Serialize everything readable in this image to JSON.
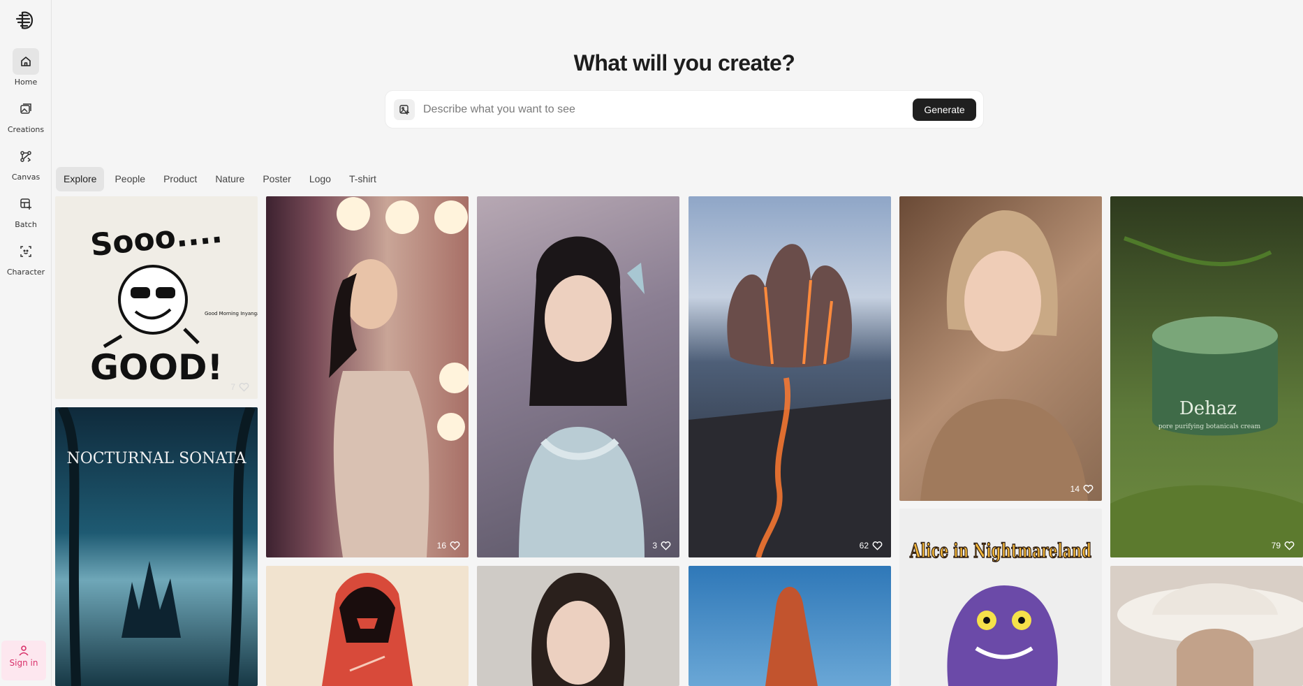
{
  "nav": [
    {
      "label": "Home",
      "icon": "home-icon",
      "active": true
    },
    {
      "label": "Creations",
      "icon": "image-icon"
    },
    {
      "label": "Canvas",
      "icon": "canvas-icon"
    },
    {
      "label": "Batch",
      "icon": "batch-icon"
    },
    {
      "label": "Character",
      "icon": "character-icon"
    }
  ],
  "signin_label": "Sign in",
  "heading": "What will you create?",
  "prompt": {
    "placeholder": "Describe what you want to see",
    "generate_label": "Generate"
  },
  "tabs": [
    "Explore",
    "People",
    "Product",
    "Nature",
    "Poster",
    "Logo",
    "T-shirt"
  ],
  "cards": {
    "sooo_good": {
      "title_top": "Sooo....",
      "title_bottom": "GOOD!",
      "small_text": "Good Morning Inyanga",
      "likes": "7"
    },
    "nocturnal": {
      "title": "NOCTURNAL SONATA"
    },
    "silk_dress": {
      "likes": "16"
    },
    "blue_ruffle": {
      "likes": "3"
    },
    "lava": {
      "likes": "62"
    },
    "blonde": {
      "likes": "14"
    },
    "dehaz": {
      "brand": "Dehaz",
      "tagline": "pore purifying botanicals cream",
      "likes": "79"
    },
    "alice": {
      "title": "Alice in Nightmareland"
    }
  },
  "colors": {
    "accent_pink": "#d8316a",
    "generate_bg": "#1f1f1f"
  }
}
